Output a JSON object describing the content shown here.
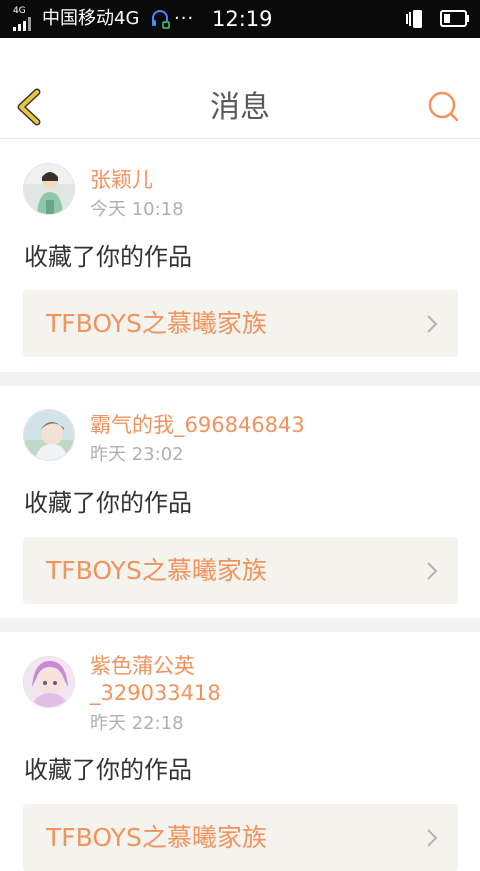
{
  "status_bar": {
    "network_type": "4G",
    "carrier": "中国移动4G",
    "more": "···",
    "time": "12:19"
  },
  "header": {
    "title": "消息",
    "back_icon": "chevron-left-icon",
    "search_icon": "search-icon"
  },
  "colors": {
    "accent": "#f0935d",
    "back_arrow": "#e8c53a",
    "work_bg": "#f4f3ee",
    "divider": "#f3f3f3"
  },
  "messages": [
    {
      "user_name": "张颖儿",
      "time": "今天 10:18",
      "action": "收藏了你的作品",
      "work_title": "TFBOYS之慕曦家族"
    },
    {
      "user_name": "霸气的我_696846843",
      "time": "昨天 23:02",
      "action": "收藏了你的作品",
      "work_title": "TFBOYS之慕曦家族"
    },
    {
      "user_name_line1": "紫色蒲公英",
      "user_name_line2": "_329033418",
      "time": "昨天 22:18",
      "action": "收藏了你的作品",
      "work_title": "TFBOYS之慕曦家族"
    }
  ]
}
